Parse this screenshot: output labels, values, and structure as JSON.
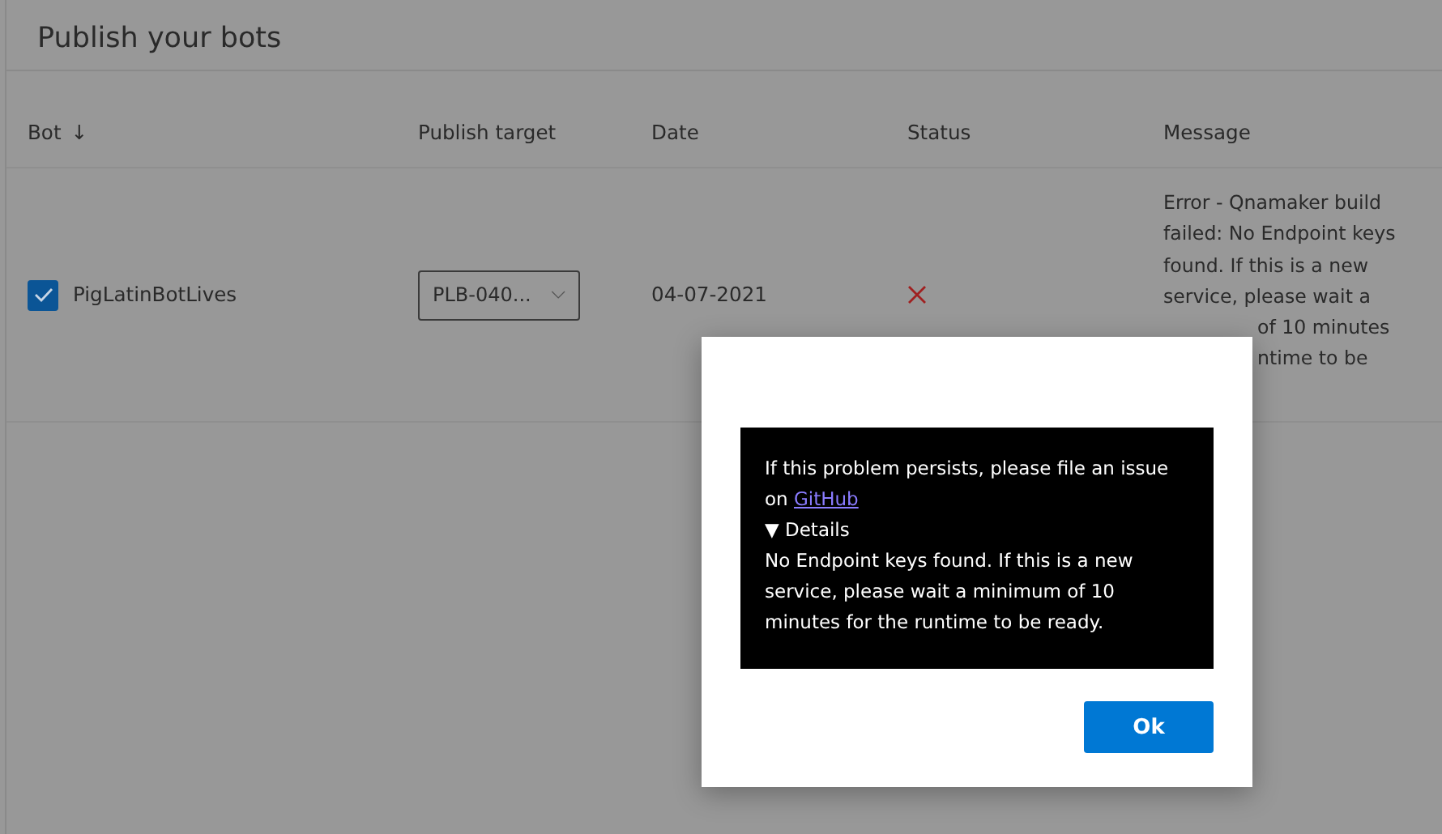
{
  "page": {
    "title": "Publish your bots"
  },
  "table": {
    "columns": [
      {
        "label": "Bot",
        "sort_icon": "↓"
      },
      {
        "label": "Publish target"
      },
      {
        "label": "Date"
      },
      {
        "label": "Status"
      },
      {
        "label": "Message"
      }
    ],
    "rows": [
      {
        "checked": true,
        "bot": "PigLatinBotLives",
        "publish_target": "PLB-040...",
        "date": "04-07-2021",
        "failed": true,
        "message_lines": [
          "Error - Qnamaker build",
          "failed: No Endpoint keys",
          "found. If this is a new",
          "service, please wait a",
          "of 10 minutes",
          "ntime to be"
        ]
      }
    ]
  },
  "dialog": {
    "notice": "If this problem persists, please file an issue on",
    "link": "GitHub",
    "details_toggle": "▼ Details",
    "details": "No Endpoint keys found. If this is a new service, please wait a minimum of 10 minutes for the runtime to be ready.",
    "button": "Ok"
  }
}
